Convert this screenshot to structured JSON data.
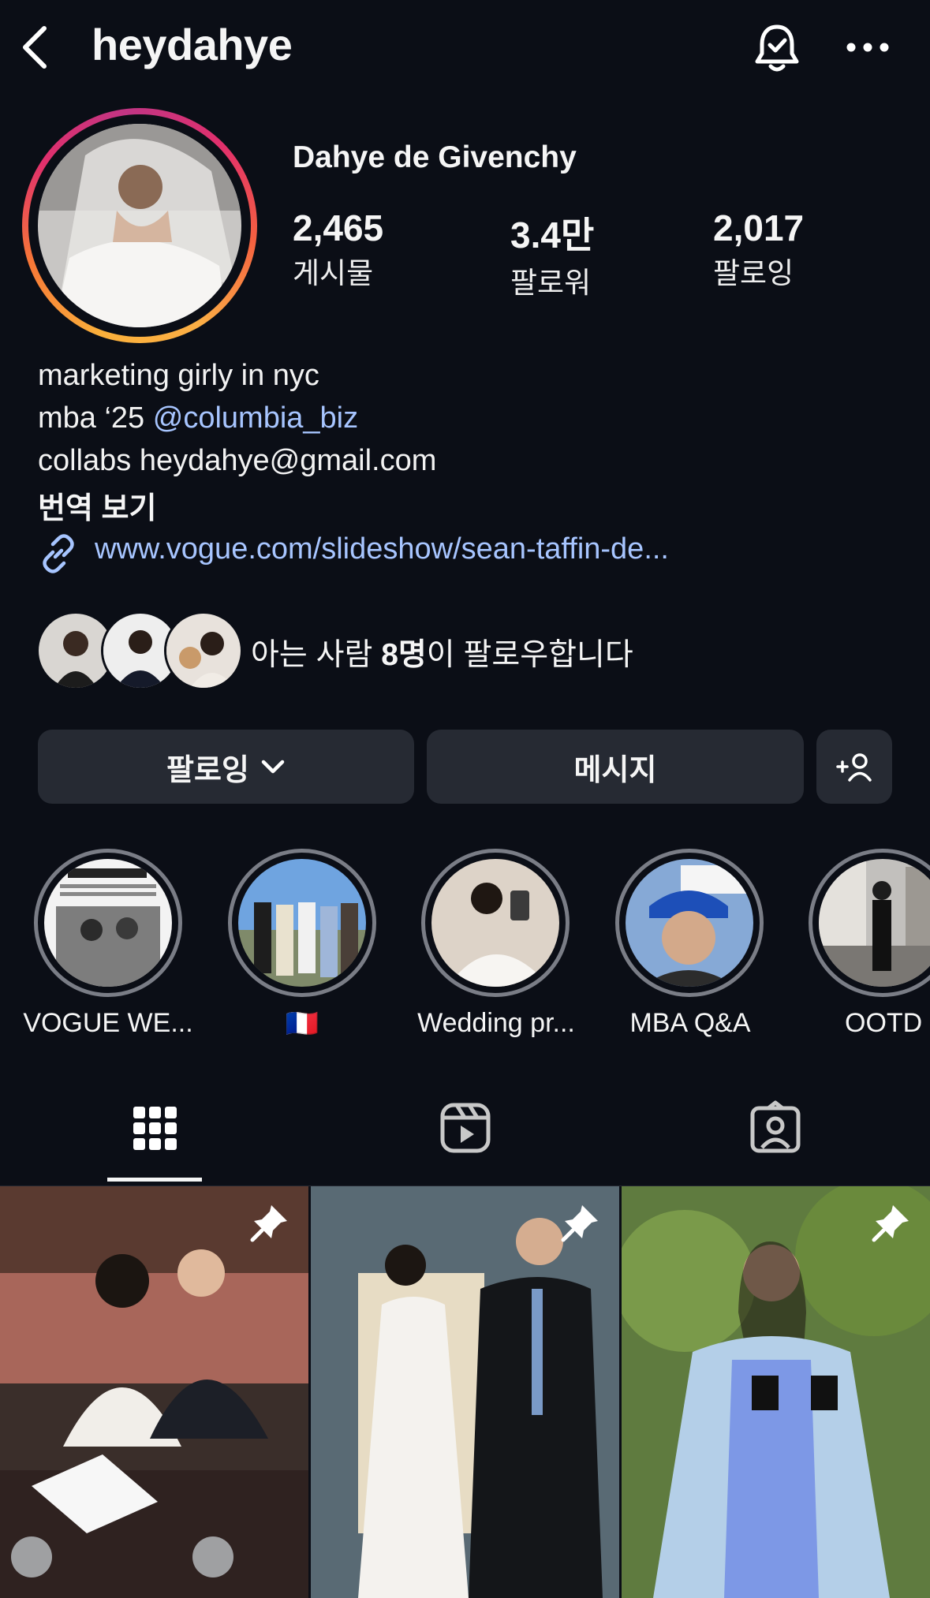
{
  "header": {
    "username": "heydahye"
  },
  "profile": {
    "display_name": "Dahye de Givenchy",
    "stats": [
      {
        "value": "2,465",
        "label": "게시물"
      },
      {
        "value": "3.4만",
        "label": "팔로워"
      },
      {
        "value": "2,017",
        "label": "팔로잉"
      }
    ],
    "bio": {
      "line1": "marketing girly in nyc",
      "line2_prefix": "mba ‘25 ",
      "line2_mention": "@columbia_biz",
      "line3": "collabs heydahye@gmail.com"
    },
    "translate_label": "번역 보기",
    "link": "www.vogue.com/slideshow/sean-taffin-de..."
  },
  "mutuals": {
    "prefix": "아는 사람 ",
    "count": "8명",
    "suffix": "이 팔로우합니다"
  },
  "buttons": {
    "following": "팔로잉",
    "message": "메시지"
  },
  "highlights": [
    {
      "label": "VOGUE WE..."
    },
    {
      "label": "🇫🇷"
    },
    {
      "label": "Wedding pr..."
    },
    {
      "label": "MBA Q&A"
    },
    {
      "label": "OOTD"
    }
  ],
  "icons": {
    "back": "chevron-left-icon",
    "bell": "bell-check-icon",
    "more": "more-horizontal-icon",
    "link": "link-icon",
    "add_person": "add-person-icon",
    "grid": "grid-icon",
    "reels": "reels-icon",
    "tagged": "tagged-icon",
    "pin": "pin-icon"
  },
  "colors": {
    "background": "#0b0e16",
    "button": "#262a33",
    "link": "#a7c5ff",
    "highlight_ring": "#7a7d86"
  }
}
